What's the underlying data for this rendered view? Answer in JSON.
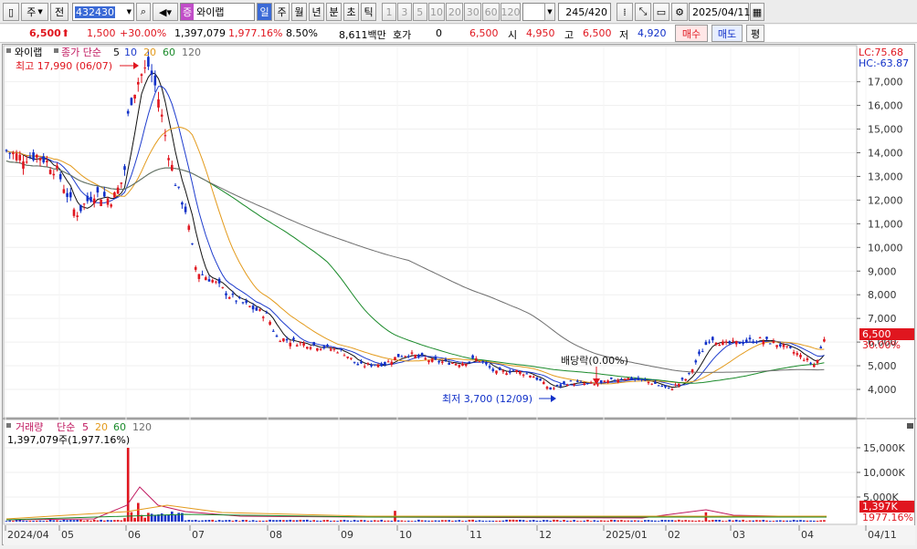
{
  "toolbar": {
    "mode_1": "주",
    "mode_2": "전",
    "code": "432430",
    "badge": "증",
    "stock_name": "와이랩",
    "periods": [
      "일",
      "주",
      "월",
      "년",
      "분",
      "초",
      "틱"
    ],
    "intervals": [
      "1",
      "3",
      "5",
      "10",
      "20",
      "30",
      "60",
      "120"
    ],
    "count": "245",
    "count_total": "/420",
    "date": "2025/04/11"
  },
  "info": {
    "price": "6,500",
    "change": "1,500",
    "change_pct": "+30.00%",
    "volume": "1,397,079",
    "volume_pct": "1,977.16%",
    "turnover_rate": "8.50%",
    "amount": "8,611백만",
    "hoga_label": "호가",
    "hoga_value": "0",
    "hoga_price": "6,500",
    "open_label": "시",
    "open": "4,950",
    "high_label": "고",
    "high": "6,500",
    "low_label": "저",
    "low": "4,920",
    "buy": "매수",
    "sell": "매도",
    "eval": "평"
  },
  "price_panel": {
    "name": "와이랩",
    "legend_prefix": "종가 단순",
    "ma": [
      "5",
      "10",
      "20",
      "60",
      "120"
    ],
    "lc": "LC:75.68",
    "hc": "HC:-63.87",
    "high_note": "최고 17,990 (06/07)",
    "low_note": "최저 3,700 (12/09)",
    "dividend_note": "배당락(0.00%)",
    "current_price": "6,500",
    "current_pct": "30.00%",
    "y_ticks": [
      "17,000",
      "16,000",
      "15,000",
      "14,000",
      "13,000",
      "12,000",
      "11,000",
      "10,000",
      "9,000",
      "8,000",
      "7,000",
      "6,000",
      "5,000",
      "4,000"
    ]
  },
  "volume_panel": {
    "legend_label": "거래량",
    "legend_prefix": "단순",
    "ma": [
      "5",
      "20",
      "60",
      "120"
    ],
    "value_note": "1,397,079주(1,977.16%)",
    "current": "1,397K",
    "current_pct": "1977.16%",
    "y_ticks": [
      "15,000K",
      "10,000K",
      "5,000K"
    ]
  },
  "x_axis": [
    "2024/04",
    "05",
    "06",
    "07",
    "08",
    "09",
    "10",
    "11",
    "12",
    "2025/01",
    "02",
    "03",
    "04",
    "04/11"
  ],
  "colors": {
    "up": "#e0161f",
    "down": "#1030c8",
    "ma5": "#111111",
    "ma10": "#1e3ccd",
    "ma20": "#e39a1b",
    "ma60": "#1a8a2a",
    "ma120": "#6e6e6e"
  }
}
